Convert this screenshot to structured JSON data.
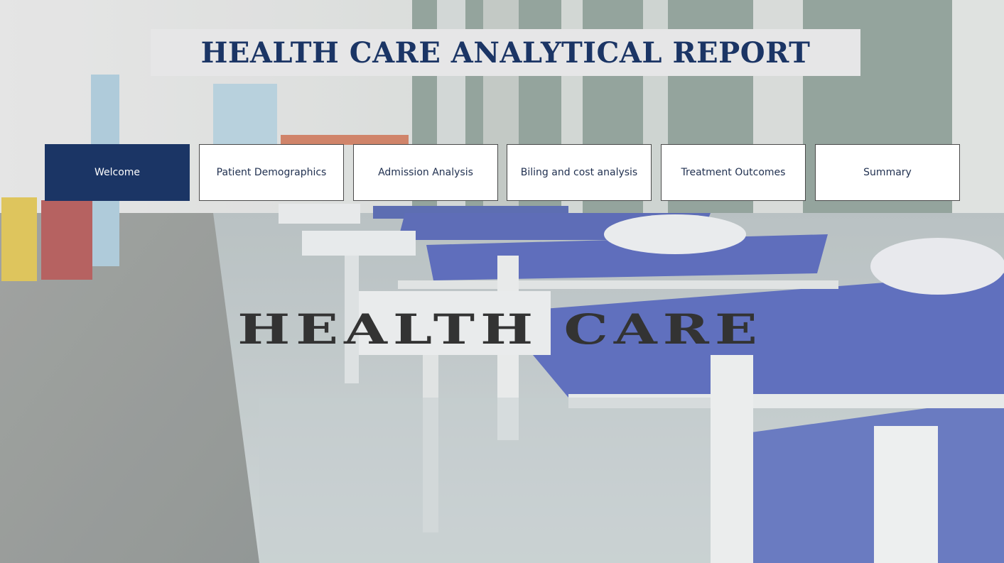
{
  "report": {
    "title": "HEALTH CARE ANALYTICAL REPORT",
    "hero_text": "HEALTH CARE"
  },
  "nav": {
    "items": [
      {
        "label": "Welcome",
        "active": true
      },
      {
        "label": "Patient Demographics",
        "active": false
      },
      {
        "label": "Admission Analysis",
        "active": false
      },
      {
        "label": "Biling and cost analysis",
        "active": false
      },
      {
        "label": "Treatment Outcomes",
        "active": false
      },
      {
        "label": "Summary",
        "active": false
      }
    ]
  },
  "colors": {
    "primary_navy": "#1b3565",
    "banner_bg": "#e6e6e7",
    "button_bg": "#ffffff",
    "hero_text": "#333333"
  },
  "background": {
    "icon": "hospital-ward-image"
  }
}
